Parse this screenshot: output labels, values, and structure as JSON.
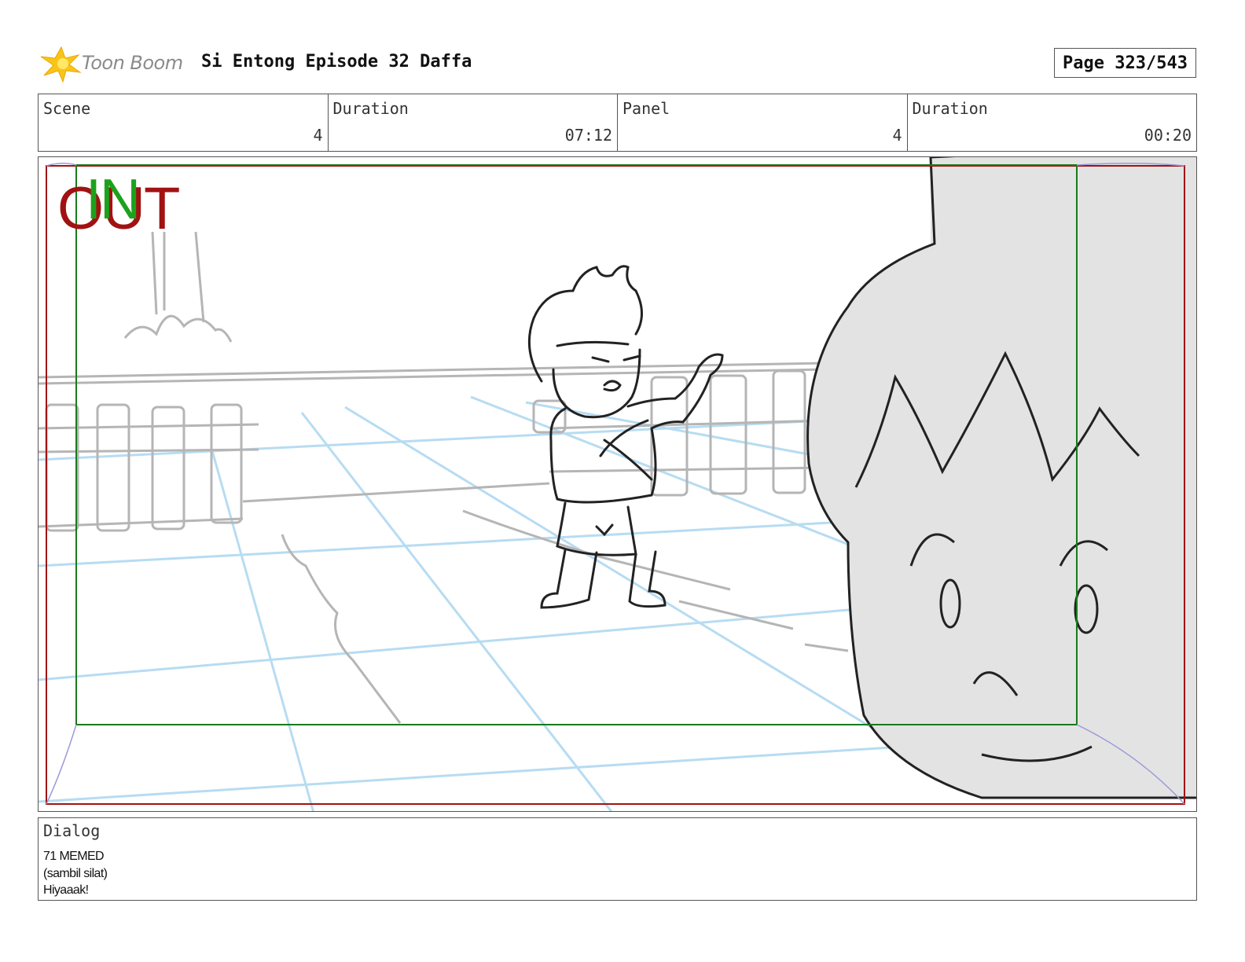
{
  "header": {
    "logo_text": "Toon Boom",
    "title": "Si Entong Episode 32 Daffa",
    "page": "Page 323/543"
  },
  "info": {
    "scene_label": "Scene",
    "scene_value": "4",
    "scene_duration_label": "Duration",
    "scene_duration_value": "07:12",
    "panel_label": "Panel",
    "panel_value": "4",
    "panel_duration_label": "Duration",
    "panel_duration_value": "00:20"
  },
  "panel": {
    "out_label": "OUT",
    "in_label": "IN",
    "colors": {
      "out_frame": "#a11212",
      "in_frame": "#1a7a1a",
      "guide_lines": "#b7dcf2",
      "sketch": "#222222"
    }
  },
  "dialog": {
    "label": "Dialog",
    "lines": [
      "71 MEMED",
      "(sambil silat)",
      "Hiyaaak!"
    ]
  }
}
